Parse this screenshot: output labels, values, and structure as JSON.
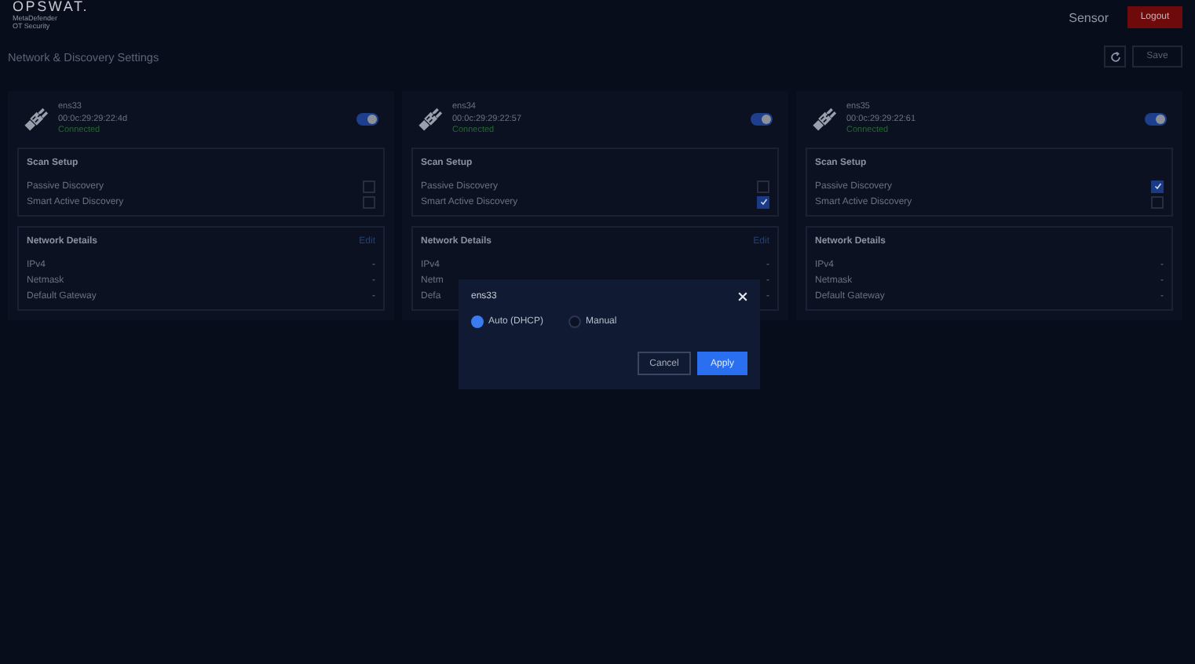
{
  "header": {
    "logo": "OPSWAT.",
    "product": "MetaDefender",
    "subtitle": "OT Security",
    "role": "Sensor",
    "logout": "Logout"
  },
  "page": {
    "title": "Network & Discovery Settings",
    "save": "Save"
  },
  "interfaces": [
    {
      "name": "ens33",
      "mac": "00:0c:29:29:22:4d",
      "status": "Connected",
      "connected": true,
      "enabled": true,
      "scan_title": "Scan Setup",
      "scan_options": [
        {
          "label": "Passive Discovery",
          "checked": false
        },
        {
          "label": "Smart Active Discovery",
          "checked": false
        }
      ],
      "details_title": "Network Details",
      "edit": "Edit",
      "details": [
        {
          "label": "IPv4",
          "value": "-"
        },
        {
          "label": "Netmask",
          "value": "-"
        },
        {
          "label": "Default Gateway",
          "value": "-"
        }
      ]
    },
    {
      "name": "ens34",
      "mac": "00:0c:29:29:22:57",
      "status": "Connected",
      "connected": true,
      "enabled": true,
      "scan_title": "Scan Setup",
      "scan_options": [
        {
          "label": "Passive Discovery",
          "checked": false
        },
        {
          "label": "Smart Active Discovery",
          "checked": true
        }
      ],
      "details_title": "Network Details",
      "edit": "Edit",
      "details": [
        {
          "label": "IPv4",
          "value": "-"
        },
        {
          "label": "Netm",
          "value": "-"
        },
        {
          "label": "Defa",
          "value": "-"
        }
      ]
    },
    {
      "name": "ens35",
      "mac": "00:0c:29:29:22:61",
      "status": "Connected",
      "connected": true,
      "enabled": true,
      "scan_title": "Scan Setup",
      "scan_options": [
        {
          "label": "Passive Discovery",
          "checked": true
        },
        {
          "label": "Smart Active Discovery",
          "checked": false
        }
      ],
      "details_title": "Network Details",
      "details": [
        {
          "label": "IPv4",
          "value": "-"
        },
        {
          "label": "Netmask",
          "value": "-"
        },
        {
          "label": "Default Gateway",
          "value": "-"
        }
      ]
    }
  ],
  "dialog": {
    "title": "ens33",
    "options": [
      {
        "label": "Auto (DHCP)",
        "selected": true
      },
      {
        "label": "Manual",
        "selected": false
      }
    ],
    "cancel": "Cancel",
    "apply": "Apply"
  }
}
